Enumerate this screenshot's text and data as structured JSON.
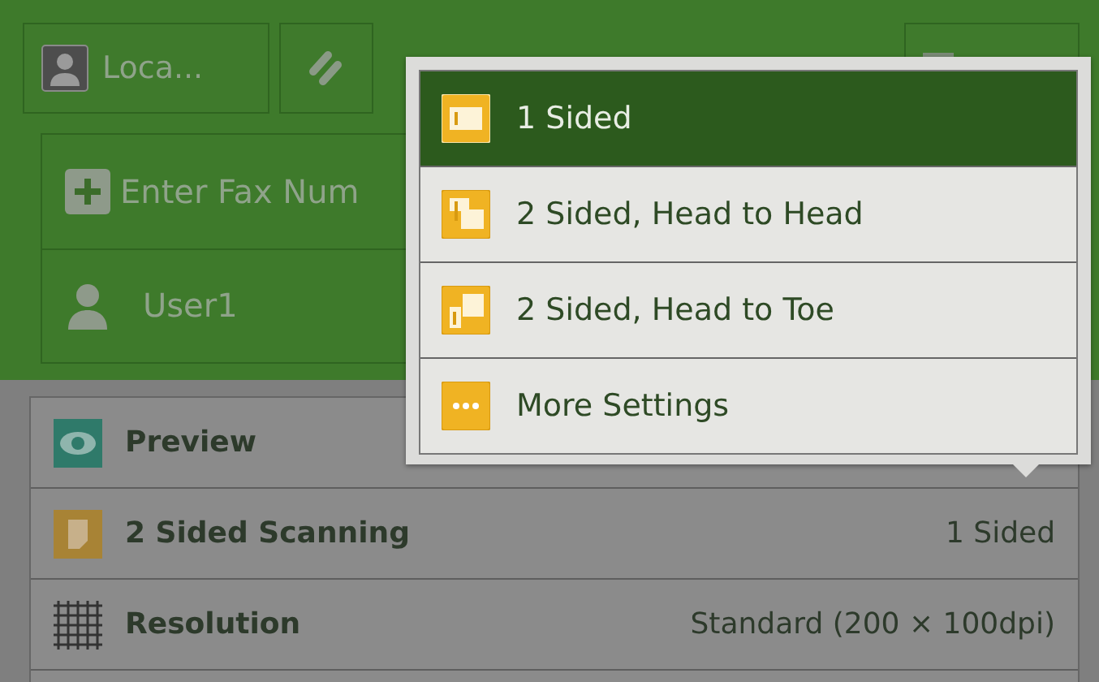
{
  "toolbar": {
    "account_label": "Loca..."
  },
  "recipient_panel": {
    "placeholder": "Enter Fax Num",
    "user": "User1"
  },
  "features": [
    {
      "kind": "preview",
      "label": "Preview"
    },
    {
      "kind": "duplex",
      "label": "2 Sided Scanning",
      "value": "1 Sided"
    },
    {
      "kind": "resolution",
      "label": "Resolution",
      "value": "Standard (200 × 100dpi)"
    }
  ],
  "popup": {
    "options": [
      {
        "kind": "one-sided",
        "label": "1 Sided",
        "selected": true
      },
      {
        "kind": "head-to-head",
        "label": "2 Sided, Head to Head",
        "selected": false
      },
      {
        "kind": "head-to-toe",
        "label": "2 Sided, Head to Toe",
        "selected": false
      },
      {
        "kind": "more",
        "label": "More Settings",
        "selected": false
      }
    ]
  }
}
